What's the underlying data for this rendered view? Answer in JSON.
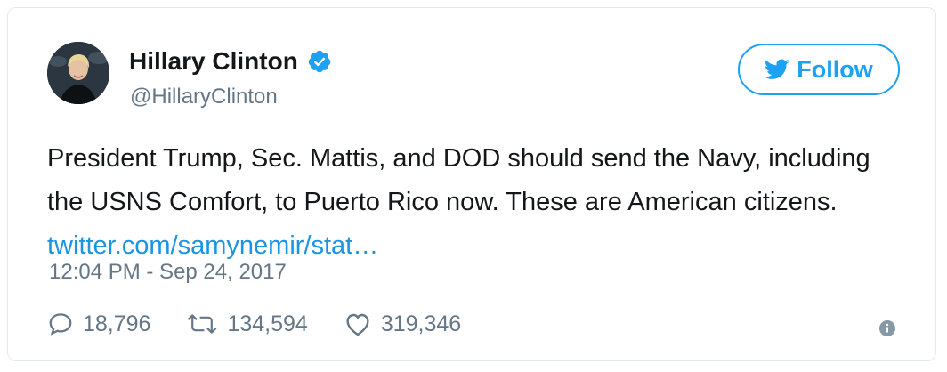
{
  "author": {
    "name": "Hillary Clinton",
    "handle": "@HillaryClinton",
    "verified": true,
    "avatar_icon": "profile-photo"
  },
  "follow_button": {
    "label": "Follow",
    "icon": "twitter-bird-icon",
    "color": "#1da1f2"
  },
  "tweet": {
    "text": "President Trump, Sec. Mattis, and DOD should send the Navy, including the USNS Comfort, to Puerto Rico now. These are American citizens. ",
    "link_text": "twitter.com/samynemir/stat…",
    "link_color": "#1b95e0",
    "timestamp": "12:04 PM - Sep 24, 2017"
  },
  "stats": {
    "replies": "18,796",
    "retweets": "134,594",
    "likes": "319,346"
  },
  "colors": {
    "text": "#14171a",
    "muted": "#657786",
    "border": "#e1e8ed"
  }
}
